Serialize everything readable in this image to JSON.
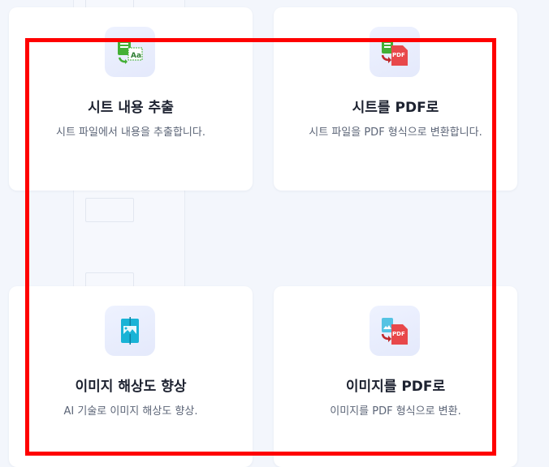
{
  "cards": [
    {
      "title": "시트 내용 추출",
      "description": "시트 파일에서 내용을 추출합니다.",
      "icon": "sheet-extract-icon"
    },
    {
      "title": "시트를 PDF로",
      "description": "시트 파일을 PDF 형식으로 변환합니다.",
      "icon": "sheet-to-pdf-icon",
      "badge": "PDF"
    },
    {
      "title": "이미지 해상도 향상",
      "description": "AI 기술로 이미지 해상도 향상.",
      "icon": "image-upscale-icon"
    },
    {
      "title": "이미지를 PDF로",
      "description": "이미지를 PDF 형식으로 변환.",
      "icon": "image-to-pdf-icon",
      "badge": "PDF"
    }
  ],
  "extract_icon_text": "Aa",
  "colors": {
    "accent_green": "#43b035",
    "accent_red": "#e8484a",
    "accent_teal": "#19b3d6",
    "highlight": "#ff0000"
  }
}
